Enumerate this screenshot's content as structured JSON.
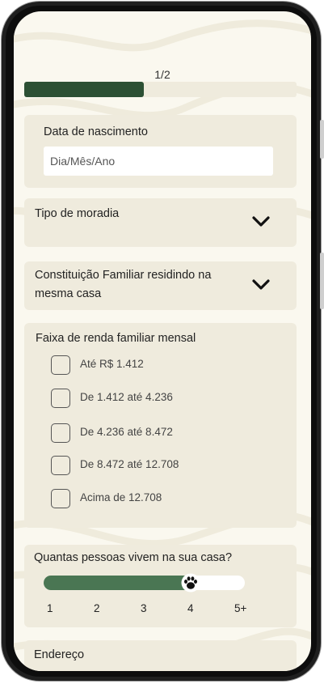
{
  "progress": {
    "label": "1/2",
    "fraction": 0.44
  },
  "birthdate": {
    "label": "Data de nascimento",
    "placeholder": "Dia/Mês/Ano"
  },
  "housing": {
    "label": "Tipo de moradia"
  },
  "family": {
    "label_line1": "Constituição Familiar residindo na",
    "label_line2": "mesma casa"
  },
  "income": {
    "label": "Faixa de renda familiar mensal",
    "options": [
      "Até R$ 1.412",
      "De 1.412 até 4.236",
      "De 4.236 até 8.472",
      "De 8.472 até 12.708",
      "Acima de 12.708"
    ]
  },
  "household": {
    "label": "Quantas pessoas vivem na sua casa?",
    "ticks": [
      "1",
      "2",
      "3",
      "4",
      "5+"
    ],
    "selected": "4",
    "thumb_icon": "paw-icon"
  },
  "address": {
    "label": "Endereço"
  },
  "colors": {
    "accent": "#2c5034",
    "slider": "#4a7653",
    "card": "#efebdd",
    "background": "#faf8ef"
  }
}
